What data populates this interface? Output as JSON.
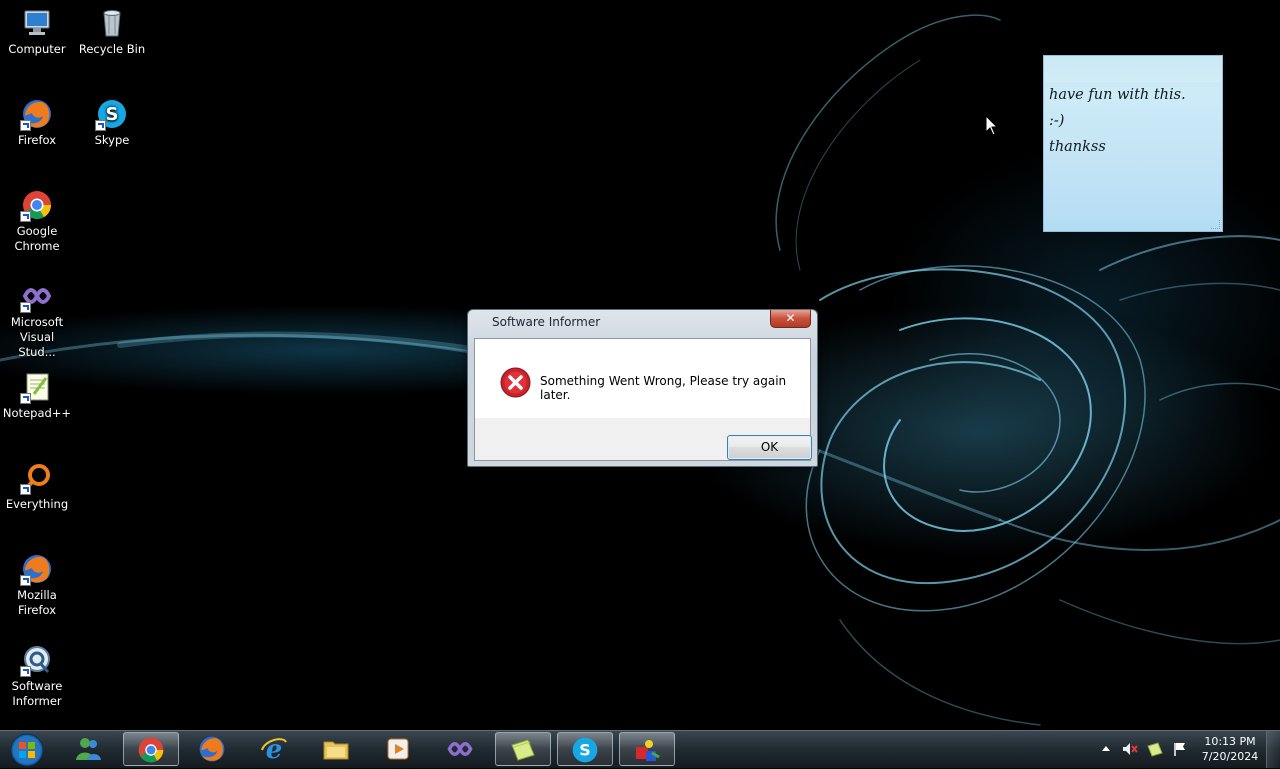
{
  "desktop": {
    "icons": [
      {
        "label": "Computer"
      },
      {
        "label": "Recycle Bin"
      },
      {
        "label": "Firefox"
      },
      {
        "label": "Skype"
      },
      {
        "label": "Google\nChrome"
      },
      {
        "label": "Microsoft\nVisual Stud..."
      },
      {
        "label": "Notepad++"
      },
      {
        "label": "Everything"
      },
      {
        "label": "Mozilla\nFirefox"
      },
      {
        "label": "Software\nInformer"
      }
    ]
  },
  "sticky_note": {
    "lines": [
      "have fun with this.",
      ":-)",
      "thankss"
    ]
  },
  "dialog": {
    "title": "Software Informer",
    "close_label": "✕",
    "message": "Something Went Wrong, Please try again later.",
    "ok_label": "OK",
    "icon": "error-icon"
  },
  "taskbar": {
    "apps": [
      {
        "icon": "windows-live-messenger-icon"
      },
      {
        "icon": "chrome-icon",
        "active": true
      },
      {
        "icon": "firefox-icon"
      },
      {
        "icon": "internet-explorer-icon"
      },
      {
        "icon": "file-explorer-icon"
      },
      {
        "icon": "media-player-icon"
      },
      {
        "icon": "visual-studio-icon"
      },
      {
        "icon": "sticky-notes-icon",
        "active": true
      },
      {
        "icon": "skype-icon",
        "active": true
      },
      {
        "icon": "software-informer-icon",
        "active": true
      }
    ],
    "clock": {
      "time": "10:13 PM",
      "date": "7/20/2024"
    }
  },
  "colors": {
    "wallpaper_accent": "#3fb4e0",
    "dialog_close_red": "#c8513c",
    "sticky_blue": "#c4e4f6"
  }
}
